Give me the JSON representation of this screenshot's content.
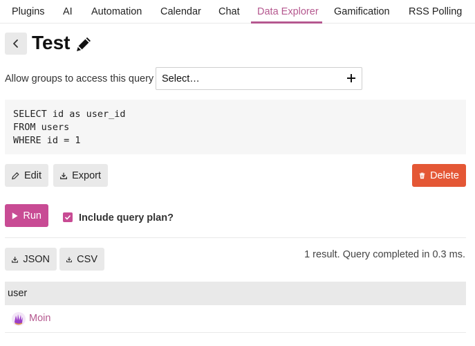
{
  "nav": {
    "tabs": [
      {
        "label": "Plugins"
      },
      {
        "label": "AI"
      },
      {
        "label": "Automation"
      },
      {
        "label": "Calendar"
      },
      {
        "label": "Chat"
      },
      {
        "label": "Data Explorer",
        "active": true
      },
      {
        "label": "Gamification"
      },
      {
        "label": "RSS Polling"
      }
    ]
  },
  "header": {
    "title": "Test",
    "icons": {
      "back": "chevron-left-icon",
      "edit": "pencil-icon"
    }
  },
  "groups": {
    "label": "Allow groups to access this query",
    "placeholder": "Select…"
  },
  "query": {
    "lines": [
      "SELECT id as user_id",
      "FROM users",
      "WHERE id = 1"
    ]
  },
  "actions": {
    "edit_label": "Edit",
    "export_label": "Export",
    "delete_label": "Delete",
    "run_label": "Run",
    "include_plan_label": "Include query plan?",
    "include_plan_checked": true
  },
  "results": {
    "json_label": "JSON",
    "csv_label": "CSV",
    "summary": "1 result. Query completed in 0.3 ms.",
    "columns": [
      "user"
    ],
    "rows": [
      {
        "user": "Moin"
      }
    ]
  },
  "colors": {
    "accent": "#b5588f",
    "primary": "#c84b94",
    "danger": "#e45735",
    "gray": "#e9e9e9"
  }
}
